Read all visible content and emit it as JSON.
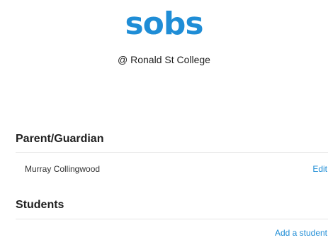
{
  "header": {
    "logo_text": "sobs",
    "school": "@ Ronald St College"
  },
  "parent_section": {
    "heading": "Parent/Guardian",
    "items": [
      {
        "name": "Murray Collingwood",
        "action": "Edit"
      }
    ]
  },
  "students_section": {
    "heading": "Students",
    "add_label": "Add a student"
  },
  "colors": {
    "brand": "#1f8dd6",
    "divider": "#e6e6e6"
  }
}
